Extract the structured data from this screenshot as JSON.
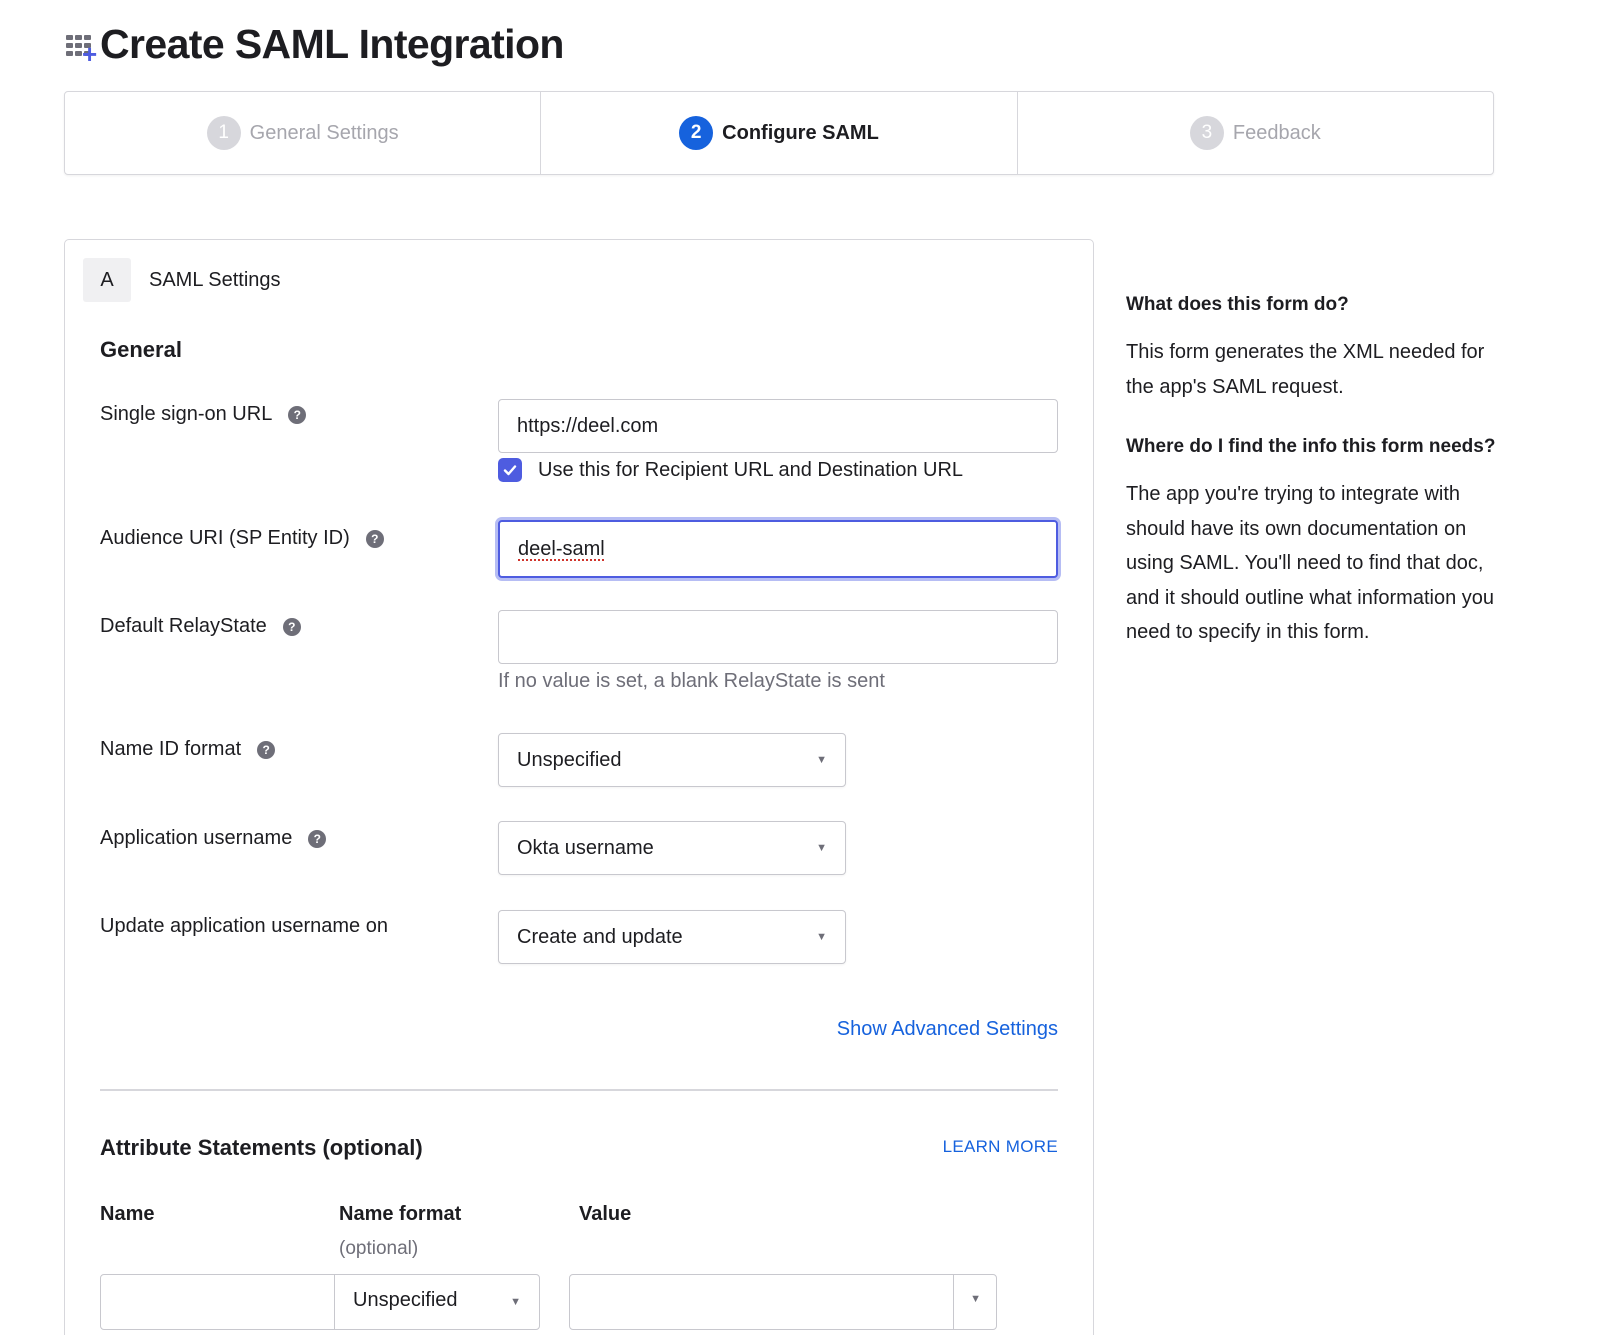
{
  "header": {
    "title": "Create SAML Integration",
    "icon": "app-grid-plus-icon"
  },
  "stepper": {
    "steps": [
      {
        "number": "1",
        "label": "General Settings",
        "state": "inactive"
      },
      {
        "number": "2",
        "label": "Configure SAML",
        "state": "active"
      },
      {
        "number": "3",
        "label": "Feedback",
        "state": "inactive"
      }
    ]
  },
  "section": {
    "letter": "A",
    "title": "SAML Settings"
  },
  "general": {
    "title": "General",
    "sso_url": {
      "label": "Single sign-on URL",
      "value": "https://deel.com"
    },
    "recipient_checkbox": {
      "label": "Use this for Recipient URL and Destination URL",
      "checked": true
    },
    "audience_uri": {
      "label": "Audience URI (SP Entity ID)",
      "value": "deel-saml"
    },
    "relay_state": {
      "label": "Default RelayState",
      "value": "",
      "hint": "If no value is set, a blank RelayState is sent"
    },
    "name_id_format": {
      "label": "Name ID format",
      "value": "Unspecified"
    },
    "app_username": {
      "label": "Application username",
      "value": "Okta username"
    },
    "update_username": {
      "label": "Update application username on",
      "value": "Create and update"
    },
    "advanced_link": "Show Advanced Settings"
  },
  "attributes": {
    "title": "Attribute Statements (optional)",
    "learn_more": "LEARN MORE",
    "columns": {
      "name": "Name",
      "name_format": "Name format",
      "name_format_sub": "(optional)",
      "value": "Value"
    },
    "row": {
      "name": "",
      "name_format": "Unspecified",
      "value": ""
    }
  },
  "help": {
    "q1": "What does this form do?",
    "a1": "This form generates the XML needed for the app's SAML request.",
    "q2": "Where do I find the info this form needs?",
    "a2": "The app you're trying to integrate with should have its own documentation on using SAML. You'll need to find that doc, and it should outline what information you need to specify in this form."
  },
  "colors": {
    "primary": "#1662dd",
    "focus": "#4e5ce0",
    "border": "#d7d7dc",
    "muted": "#6e6e78"
  }
}
